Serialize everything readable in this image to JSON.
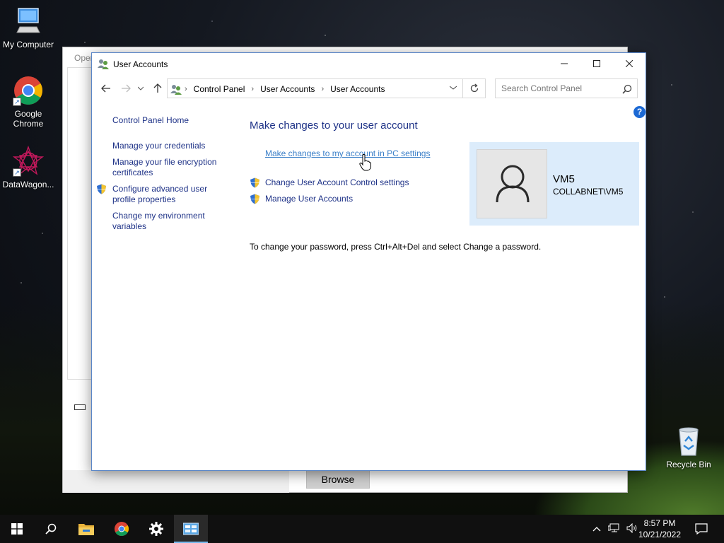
{
  "desktop": {
    "icons": [
      {
        "label": "My Computer"
      },
      {
        "label": "Google Chrome"
      },
      {
        "label": "DataWagon..."
      },
      {
        "label": "Recycle Bin"
      }
    ]
  },
  "background_window": {
    "title": "Oper",
    "browse_label": "Browse"
  },
  "window": {
    "title": "User Accounts",
    "controls": {
      "minimize": "minimize",
      "maximize": "maximize",
      "close": "close"
    }
  },
  "address_bar": {
    "crumbs": [
      "Control Panel",
      "User Accounts",
      "User Accounts"
    ],
    "search_placeholder": "Search Control Panel"
  },
  "help_label": "?",
  "sidebar": {
    "home": "Control Panel Home",
    "items": [
      {
        "label": "Manage your credentials",
        "shield": false
      },
      {
        "label": "Manage your file encryption certificates",
        "shield": false
      },
      {
        "label": "Configure advanced user profile properties",
        "shield": true
      },
      {
        "label": "Change my environment variables",
        "shield": false
      }
    ]
  },
  "main": {
    "heading": "Make changes to your user account",
    "pc_settings_link": "Make changes to my account in PC settings",
    "tasks": [
      {
        "label": "Change User Account Control settings"
      },
      {
        "label": "Manage User Accounts"
      }
    ],
    "password_note": "To change your password, press Ctrl+Alt+Del and select Change a password."
  },
  "user": {
    "name": "VM5",
    "domain": "COLLABNET\\VM5"
  },
  "taskbar": {
    "time": "8:57 PM",
    "date": "10/21/2022"
  },
  "colors": {
    "link": "#1e3287",
    "link_hover": "#3a7fc8",
    "accent": "#1c69d4",
    "tile_bg": "#dcecfb"
  }
}
